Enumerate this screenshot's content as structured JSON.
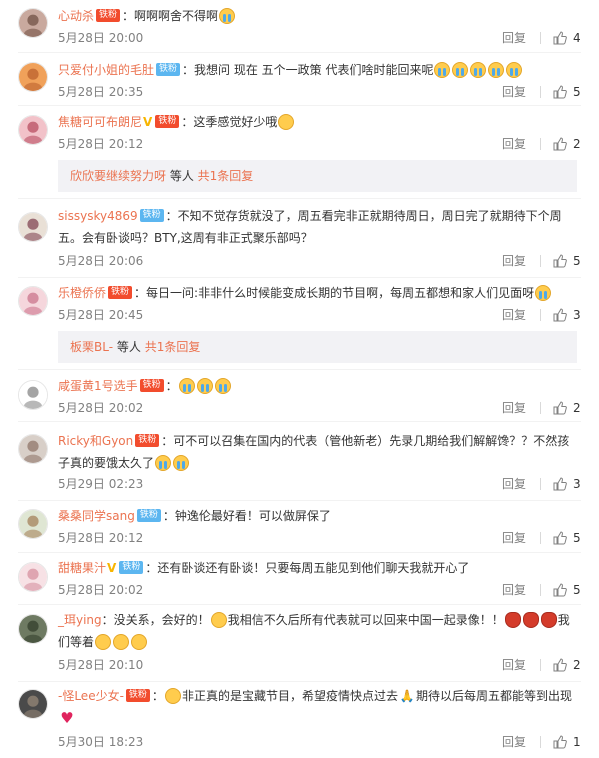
{
  "like_icon": "thumbs-up-icon",
  "reply_label": "回复",
  "colors": {
    "username": "#eb7350",
    "subreply_bg": "#f2f2f5",
    "tie_badge": "#5cb6f0",
    "fans_badge": "#f24c2d"
  },
  "comments": [
    {
      "user": "心动杀",
      "badges": [
        "fans"
      ],
      "pre": "：啊啊啊舍不得啊",
      "emojis_after": [
        "cry"
      ],
      "time": "5月28日 20:00",
      "likes": "4"
    },
    {
      "user": "只爱付小姐的毛肚",
      "badges": [
        "tie"
      ],
      "pre": "：我想问 现在 五个一政策 代表们啥时能回来呢",
      "emojis_after": [
        "cry",
        "cry",
        "cry",
        "cry",
        "cry"
      ],
      "time": "5月28日 20:35",
      "likes": "5"
    },
    {
      "user": "焦糖可可布朗尼",
      "badges": [
        "v",
        "fans"
      ],
      "pre": "：这季感觉好少哦",
      "emojis_after": [
        "face"
      ],
      "time": "5月28日 20:12",
      "likes": "2",
      "sub_user": "欣欣要继续努力呀",
      "sub_text": " 等人 ",
      "sub_more": "共1条回复"
    },
    {
      "user": "sissysky4869",
      "badges": [
        "tie"
      ],
      "pre": "：不知不觉存货就没了，周五看完非正就期待周日，周日完了就期待下个周五。会有卧谈吗？BTY,这周有非正式聚乐部吗？",
      "emojis_after": [],
      "time": "5月28日 20:06",
      "likes": "5"
    },
    {
      "user": "乐橙侨侨",
      "badges": [
        "fans"
      ],
      "pre": "：每日一问:非非什么时候能变成长期的节目啊，每周五都想和家人们见面呀",
      "emojis_after": [
        "cry"
      ],
      "time": "5月28日 20:45",
      "likes": "3",
      "sub_user": "板栗BL-",
      "sub_text": " 等人 ",
      "sub_more": "共1条回复"
    },
    {
      "user": "咸蛋黄1号选手",
      "badges": [
        "fans"
      ],
      "pre": "：",
      "emojis_after": [
        "cry",
        "cry",
        "cry"
      ],
      "time": "5月28日 20:02",
      "likes": "2"
    },
    {
      "user": "Ricky和Gyon",
      "badges": [
        "fans"
      ],
      "pre": "：可不可以召集在国内的代表（管他新老）先录几期给我们解解馋？？不然孩子真的要饿太久了",
      "emojis_after": [
        "cry",
        "cry"
      ],
      "time": "5月29日 02:23",
      "likes": "3"
    },
    {
      "user": "桑桑同学sang",
      "badges": [
        "tie"
      ],
      "pre": "：钟逸伦最好看！可以做屏保了",
      "emojis_after": [],
      "time": "5月28日 20:12",
      "likes": "5"
    },
    {
      "user": "甜糖果汁",
      "badges": [
        "v",
        "tie"
      ],
      "pre": "：还有卧谈还有卧谈！只要每周五能见到他们聊天我就开心了",
      "emojis_after": [],
      "time": "5月28日 20:02",
      "likes": "5"
    },
    {
      "user": "_珥ying",
      "badges": [],
      "pre": "：没关系，会好的！",
      "emojis_mid1": [
        "grin"
      ],
      "mid1": "我相信不久后所有代表就可以回来中国一起录像！！",
      "emojis_mid2": [
        "pot",
        "pot",
        "pot"
      ],
      "mid2": "我们等着",
      "emojis_after": [
        "face",
        "face",
        "face"
      ],
      "time": "5月28日 20:10",
      "likes": "2"
    },
    {
      "user": "-怪Lee少女-",
      "badges": [
        "fans"
      ],
      "pre": "：",
      "emojis_mid1": [
        "face"
      ],
      "mid1": "非正真的是宝藏节目，希望疫情快点过去",
      "emojis_mid2": [
        "pray"
      ],
      "mid2": "期待以后每周五都能等到出现",
      "emojis_after": [
        "heart"
      ],
      "time": "5月30日 18:23",
      "likes": "1"
    }
  ],
  "badge_labels": {
    "tie": "铁粉",
    "fans": "铁粉",
    "v": "V"
  }
}
